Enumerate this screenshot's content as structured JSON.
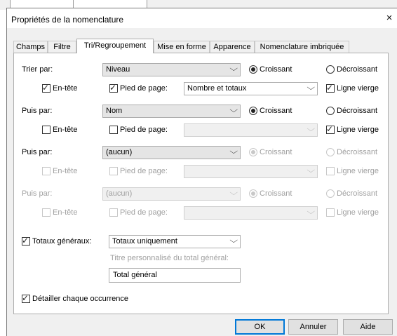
{
  "dialog": {
    "title": "Propriétés de la nomenclature",
    "close_icon": "×"
  },
  "tabs": [
    "Champs",
    "Filtre",
    "Tri/Regroupement",
    "Mise en forme",
    "Apparence",
    "Nomenclature imbriquée"
  ],
  "active_tab": "Tri/Regroupement",
  "common": {
    "croissant": "Croissant",
    "decroissant": "Décroissant",
    "en_tete": "En-tête",
    "pied_de_page": "Pied de page:",
    "ligne_vierge": "Ligne vierge"
  },
  "sort_rows": [
    {
      "label": "Trier par:",
      "field": "Niveau",
      "croissant": true,
      "en_tete": true,
      "pied": true,
      "pied_value": "Nombre et totaux",
      "ligne_vierge": true,
      "enabled": true
    },
    {
      "label": "Puis par:",
      "field": "Nom",
      "croissant": true,
      "en_tete": false,
      "pied": false,
      "pied_value": "",
      "ligne_vierge": true,
      "enabled": true
    },
    {
      "label": "Puis par:",
      "field": "(aucun)",
      "croissant": true,
      "en_tete": false,
      "pied": false,
      "pied_value": "",
      "ligne_vierge": false,
      "enabled": true
    },
    {
      "label": "Puis par:",
      "field": "(aucun)",
      "croissant": true,
      "en_tete": false,
      "pied": false,
      "pied_value": "",
      "ligne_vierge": false,
      "enabled": false
    }
  ],
  "totaux": {
    "label": "Totaux généraux:",
    "checked": true,
    "value": "Totaux uniquement",
    "custom_title_hint": "Titre personnalisé du total général:",
    "custom_title_value": "Total général"
  },
  "detail": {
    "label": "Détailler chaque occurrence",
    "checked": true
  },
  "buttons": {
    "ok": "OK",
    "annuler": "Annuler",
    "aide": "Aide"
  },
  "glyphs": {
    "chevron": "⌵",
    "check": "✓"
  }
}
